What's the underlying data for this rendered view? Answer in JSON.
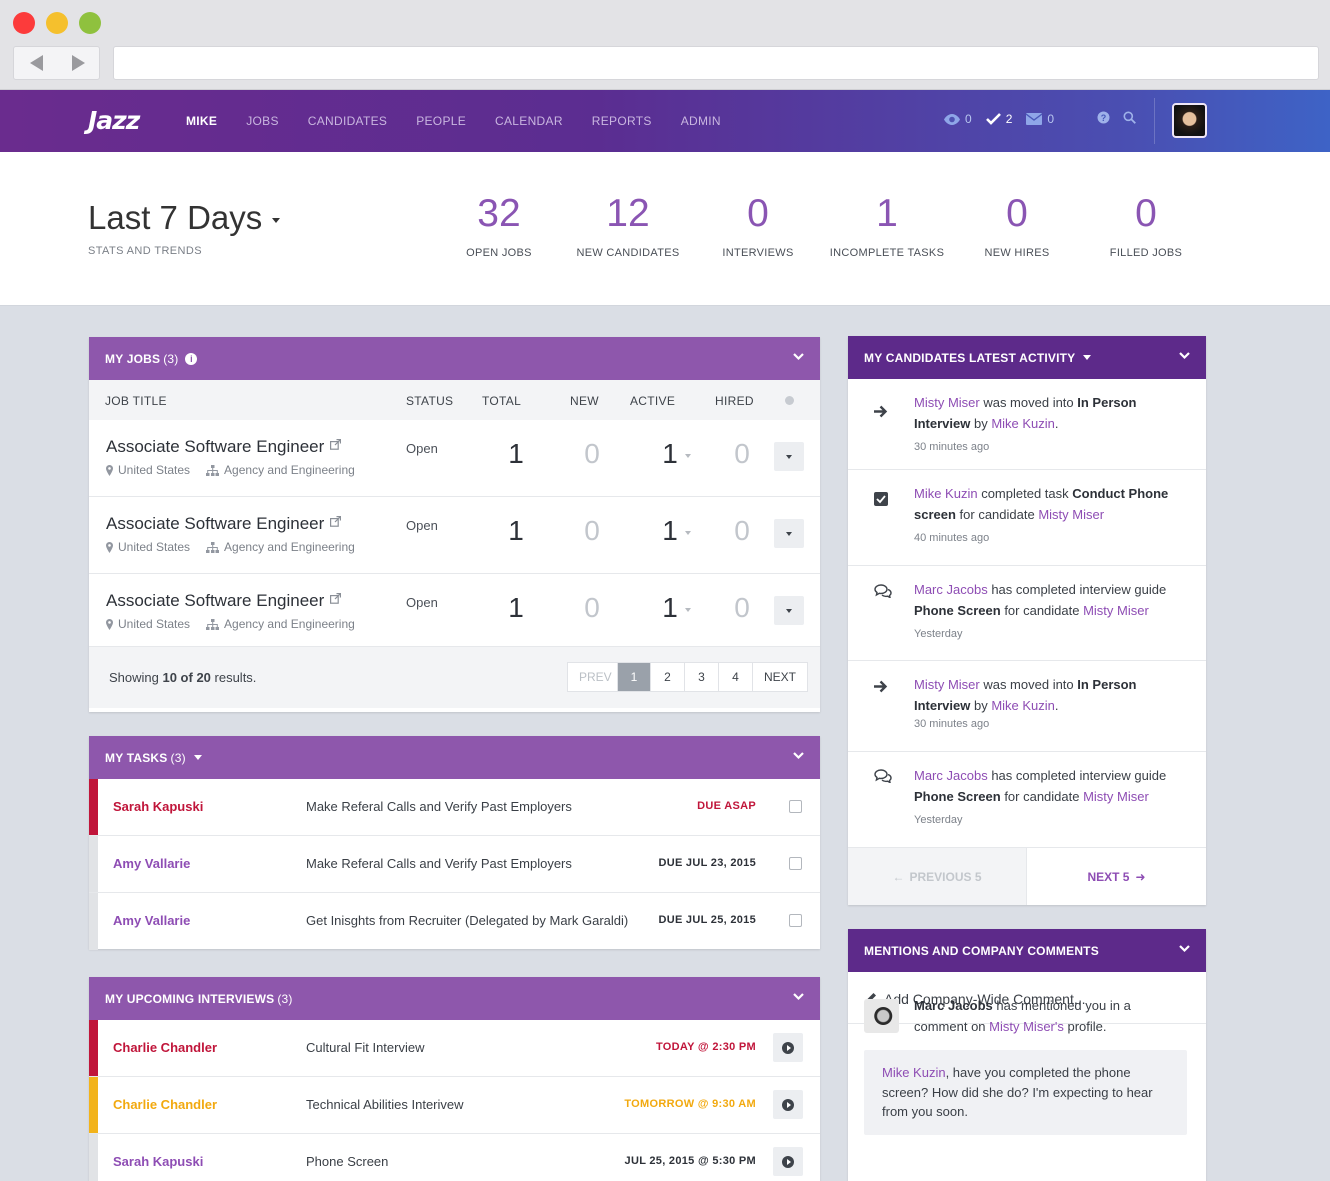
{
  "app": {
    "logo": "Jazz"
  },
  "nav": {
    "items": [
      {
        "label": "MIKE",
        "active": true
      },
      {
        "label": "JOBS"
      },
      {
        "label": "CANDIDATES"
      },
      {
        "label": "PEOPLE"
      },
      {
        "label": "CALENDAR"
      },
      {
        "label": "REPORTS"
      },
      {
        "label": "ADMIN"
      }
    ],
    "counters": {
      "views": "0",
      "tasks": "2",
      "messages": "0"
    }
  },
  "stats": {
    "period": "Last 7 Days",
    "subtitle": "STATS AND TRENDS",
    "items": [
      {
        "value": "32",
        "label": "OPEN JOBS"
      },
      {
        "value": "12",
        "label": "NEW CANDIDATES"
      },
      {
        "value": "0",
        "label": "INTERVIEWS"
      },
      {
        "value": "1",
        "label": "INCOMPLETE TASKS"
      },
      {
        "value": "0",
        "label": "NEW HIRES"
      },
      {
        "value": "0",
        "label": "FILLED JOBS"
      }
    ]
  },
  "jobs": {
    "title": "MY JOBS",
    "count": "(3)",
    "columns": [
      "JOB TITLE",
      "STATUS",
      "TOTAL",
      "NEW",
      "ACTIVE",
      "HIRED"
    ],
    "rows": [
      {
        "title": "Associate Software Engineer",
        "location": "United States",
        "department": "Agency and Engineering",
        "status": "Open",
        "total": "1",
        "new": "0",
        "active": "1",
        "hired": "0"
      },
      {
        "title": "Associate Software Engineer",
        "location": "United States",
        "department": "Agency and Engineering",
        "status": "Open",
        "total": "1",
        "new": "0",
        "active": "1",
        "hired": "0"
      },
      {
        "title": "Associate Software Engineer",
        "location": "United States",
        "department": "Agency and Engineering",
        "status": "Open",
        "total": "1",
        "new": "0",
        "active": "1",
        "hired": "0"
      }
    ],
    "footer": {
      "showing_pre": "Showing ",
      "showing_bold": "10 of 20",
      "showing_post": " results."
    },
    "pager": {
      "prev": "PREV",
      "pages": [
        "1",
        "2",
        "3",
        "4"
      ],
      "next": "NEXT",
      "current": "1"
    }
  },
  "tasks": {
    "title": "MY TASKS",
    "count": "(3)",
    "rows": [
      {
        "who": "Sarah Kapuski",
        "what": "Make Referal Calls and Verify Past Employers",
        "due": "DUE ASAP",
        "color": "#c0153a"
      },
      {
        "who": "Amy Vallarie",
        "what": "Make Referal Calls and Verify Past Employers",
        "due": "DUE JUL 23, 2015",
        "color": "#8e4db4"
      },
      {
        "who": "Amy Vallarie",
        "what": "Get Inisghts from Recruiter (Delegated by Mark Garaldi)",
        "due": "DUE JUL 25, 2015",
        "color": "#8e4db4"
      }
    ]
  },
  "interviews": {
    "title": "MY UPCOMING INTERVIEWS",
    "count": "(3)",
    "rows": [
      {
        "who": "Charlie Chandler",
        "what": "Cultural Fit Interview",
        "when": "TODAY @ 2:30 PM",
        "color": "#c0153a"
      },
      {
        "who": "Charlie Chandler",
        "what": "Technical Abilities Interivew",
        "when": "TOMORROW @ 9:30 AM",
        "color": "#f2a90f"
      },
      {
        "who": "Sarah Kapuski",
        "what": "Phone Screen",
        "when": "JUL 25, 2015 @ 5:30 PM",
        "color": "#8e4db4"
      }
    ]
  },
  "activity": {
    "title": "MY CANDIDATES LATEST ACTIVITY",
    "items": [
      {
        "icon": "arrow-right-icon",
        "a": "Misty Miser",
        "b": " was moved into ",
        "c": "In Person Interview",
        "d": " by ",
        "e": "Mike Kuzin",
        "f": ".",
        "time": "30 minutes ago"
      },
      {
        "icon": "checkbox-checked-icon",
        "a": "Mike Kuzin",
        "b": " completed task ",
        "c": "Conduct Phone screen",
        "d": " for candidate ",
        "e": "Misty Miser",
        "f": "",
        "time": "40 minutes ago"
      },
      {
        "icon": "comments-icon",
        "a": "Marc Jacobs",
        "b": " has completed interview guide ",
        "c": "Phone Screen",
        "d": " for candidate ",
        "e": "Misty Miser",
        "f": "",
        "time": "Yesterday"
      },
      {
        "icon": "arrow-right-icon",
        "a": "Misty Miser",
        "b": " was moved into ",
        "c": "In Person Interview",
        "d": " by ",
        "e": "Mike Kuzin",
        "f": ".",
        "time": "30 minutes ago"
      },
      {
        "icon": "comments-icon",
        "a": "Marc Jacobs",
        "b": " has completed interview guide ",
        "c": "Phone Screen",
        "d": " for candidate ",
        "e": "Misty Miser",
        "f": "",
        "time": "Yesterday"
      }
    ],
    "prev": "PREVIOUS 5",
    "next": "NEXT 5"
  },
  "mentions": {
    "title": "MENTIONS AND COMPANY COMMENTS",
    "add": "Add Company-Wide Comment...",
    "author": "Marc Jacobs",
    "text1": " has mentioned you in a comment on ",
    "link": "Misty Miser's",
    "text2": " profile.",
    "quote_name": "Mike Kuzin",
    "quote_text": ", have you completed the phone screen? How did she do? I'm expecting to hear from you soon."
  }
}
